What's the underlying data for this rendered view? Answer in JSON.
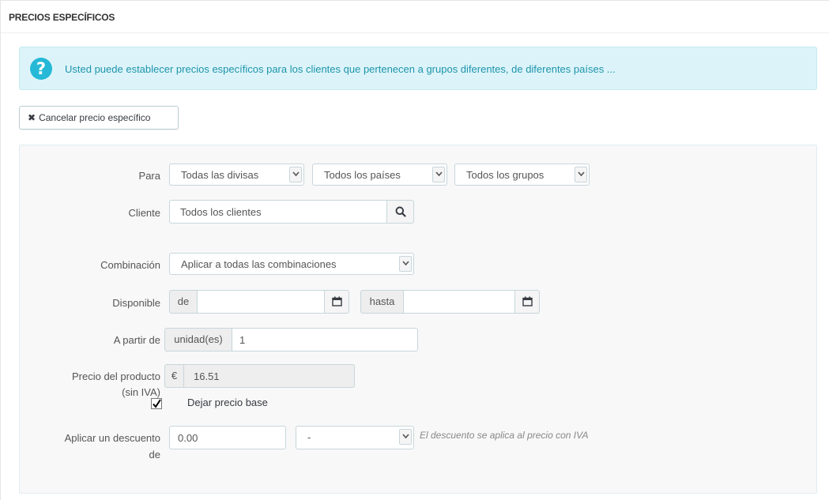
{
  "panel": {
    "title": "PRECIOS ESPECÍFICOS"
  },
  "alert": {
    "text": "Usted puede establecer precios específicos para los clientes que pertenecen a grupos diferentes, de diferentes países ..."
  },
  "cancel_button": {
    "icon": "x-icon",
    "label": "Cancelar precio específico"
  },
  "form": {
    "para": {
      "label": "Para",
      "currency": "Todas las divisas",
      "country": "Todos los países",
      "group": "Todos los grupos"
    },
    "cliente": {
      "label": "Cliente",
      "value": "Todos los clientes"
    },
    "combinacion": {
      "label": "Combinación",
      "value": "Aplicar a todas las combinaciones"
    },
    "disponible": {
      "label": "Disponible",
      "from_addon": "de",
      "to_addon": "hasta",
      "from_value": "",
      "to_value": ""
    },
    "a_partir": {
      "label": "A partir de",
      "addon": "unidad(es)",
      "value": "1"
    },
    "precio": {
      "label_line1": "Precio del producto",
      "label_line2": "(sin IVA)",
      "currency": "€",
      "value": "16.51",
      "keep_base_label": "Dejar precio base",
      "keep_base_checked": true
    },
    "descuento": {
      "label_line1": "Aplicar un descuento",
      "label_line2": "de",
      "value": "0.00",
      "type": "-",
      "hint": "El descuento se aplica al precio con IVA"
    }
  },
  "colors": {
    "accent": "#25b9d7",
    "alert_bg": "#dcf4f9",
    "alert_text": "#1e94ab"
  }
}
